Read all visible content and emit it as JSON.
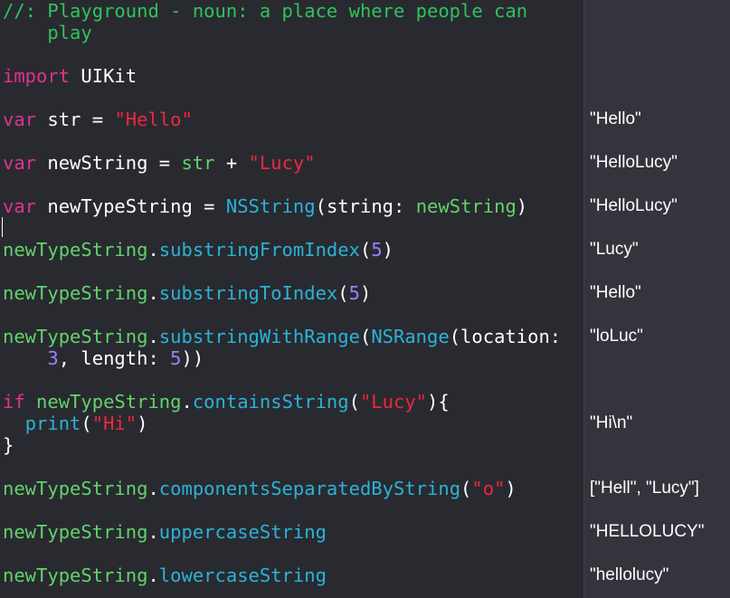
{
  "code": {
    "comment_1": "//: Playground - noun: a place where people can",
    "comment_2": "    play",
    "import_kw": "import",
    "import_mod": " UIKit",
    "var_kw": "var",
    "str_name": " str = ",
    "hello_lit": "\"Hello\"",
    "newstring_name": " newString = ",
    "str_ref": "str",
    "plus": " + ",
    "lucy_lit": "\"Lucy\"",
    "newtype_name": " newTypeString = ",
    "nsstring": "NSString",
    "string_arg": "(string: ",
    "newstring_ref": "newString",
    "close_paren": ")",
    "newtypestring": "newTypeString",
    "dot": ".",
    "substringFromIndex": "substringFromIndex",
    "substringToIndex": "substringToIndex",
    "substringWithRange": "substringWithRange",
    "open_paren": "(",
    "five": "5",
    "nsrange": "NSRange",
    "location_arg": "(location:",
    "indent": "    ",
    "three": "3",
    "length_arg": ", length: ",
    "double_close": "))",
    "if_kw": "if",
    "space": " ",
    "containsString": "containsString",
    "close_brace_open": "){",
    "print_indent": "  ",
    "print_fn": "print",
    "hi_lit": "\"Hi\"",
    "close_brace": "}",
    "componentsSeparatedByString": "componentsSeparatedByString",
    "o_lit": "\"o\"",
    "uppercaseString": "uppercaseString",
    "lowercaseString": "lowercaseString"
  },
  "results": {
    "str": "\"Hello\"",
    "newString": "\"HelloLucy\"",
    "newTypeString": "\"HelloLucy\"",
    "fromIndex": "\"Lucy\"",
    "toIndex": "\"Hello\"",
    "withRange": "\"loLuc\"",
    "print": "\"Hi\\n\"",
    "components": "[\"Hell\", \"Lucy\"]",
    "upper": "\"HELLOLUCY\"",
    "lower": "\"hellolucy\""
  }
}
